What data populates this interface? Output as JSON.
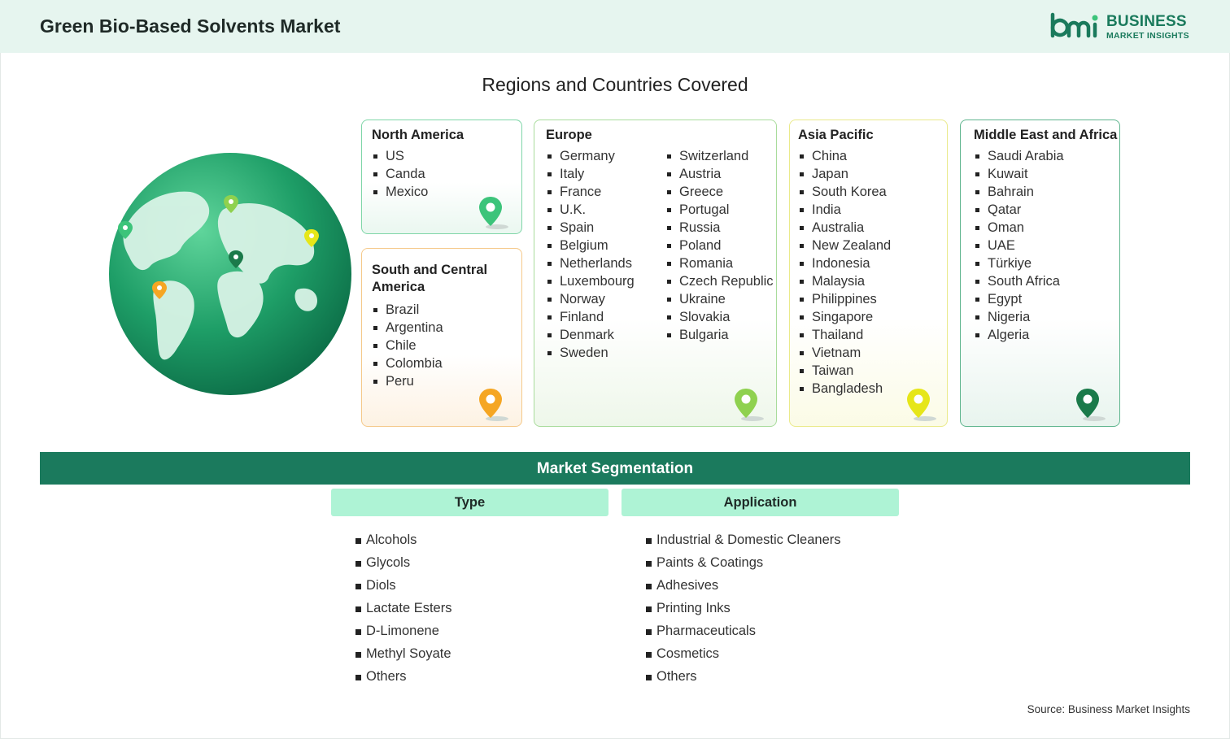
{
  "header": {
    "title": "Green Bio-Based Solvents Market"
  },
  "logo": {
    "line1": "BUSINESS",
    "line2": "MARKET INSIGHTS"
  },
  "regions_title": "Regions and Countries Covered",
  "regions": {
    "north_america": {
      "title": "North America",
      "countries": [
        "US",
        "Canda",
        "Mexico"
      ],
      "pin_color": "#3cc47a"
    },
    "south_america": {
      "title": "South and Central America",
      "countries": [
        "Brazil",
        "Argentina",
        "Chile",
        "Colombia",
        "Peru"
      ],
      "pin_color": "#f5a623"
    },
    "europe": {
      "title": "Europe",
      "col1": [
        "Germany",
        "Italy",
        "France",
        "U.K.",
        "Spain",
        "Belgium",
        "Netherlands",
        "Luxembourg",
        "Norway",
        "Finland",
        "Denmark",
        "Sweden"
      ],
      "col2": [
        "Switzerland",
        "Austria",
        "Greece",
        "Portugal",
        "Russia",
        "Poland",
        "Romania",
        "Czech Republic",
        "Ukraine",
        "Slovakia",
        "Bulgaria"
      ],
      "pin_color": "#8fd14f"
    },
    "asia_pacific": {
      "title": "Asia Pacific",
      "countries": [
        "China",
        "Japan",
        "South Korea",
        "India",
        "Australia",
        "New Zealand",
        "Indonesia",
        "Malaysia",
        "Philippines",
        "Singapore",
        "Thailand",
        "Vietnam",
        "Taiwan",
        "Bangladesh"
      ],
      "pin_color": "#e6e619"
    },
    "middle_east_africa": {
      "title": "Middle East and Africa",
      "countries": [
        "Saudi Arabia",
        "Kuwait",
        "Bahrain",
        "Qatar",
        "Oman",
        "UAE",
        "Türkiye",
        "South Africa",
        "Egypt",
        "Nigeria",
        "Algeria"
      ],
      "pin_color": "#1b7a4a"
    }
  },
  "segmentation": {
    "title": "Market Segmentation",
    "type": {
      "title": "Type",
      "items": [
        "Alcohols",
        "Glycols",
        "Diols",
        "Lactate Esters",
        "D-Limonene",
        "Methyl Soyate",
        "Others"
      ]
    },
    "application": {
      "title": "Application",
      "items": [
        "Industrial & Domestic Cleaners",
        "Paints & Coatings",
        "Adhesives",
        "Printing Inks",
        "Pharmaceuticals",
        "Cosmetics",
        "Others"
      ]
    }
  },
  "source": "Source: Business Market Insights",
  "colors": {
    "accent": "#1b7a5d",
    "header_bg": "#e6f5ef",
    "seg_head_bg": "#aef3d5"
  }
}
